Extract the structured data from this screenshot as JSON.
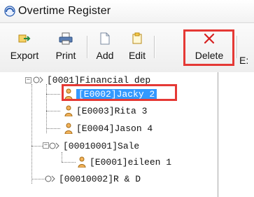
{
  "window": {
    "title": "Overtime  Register"
  },
  "toolbar": {
    "export_label": "Export",
    "print_label": "Print",
    "add_label": "Add",
    "edit_label": "Edit",
    "delete_label": "Delete",
    "next_partial_label": "E:"
  },
  "tree": {
    "root": "[0001]Financial dep",
    "items": [
      {
        "label": "[E0002]Jacky  2",
        "selected": true
      },
      {
        "label": "[E0003]Rita  3"
      },
      {
        "label": "[E0004]Jason  4"
      }
    ],
    "sub_dept": "[00010001]Sale",
    "sub_items": [
      {
        "label": "[E0001]eileen  1"
      }
    ],
    "dept2": "[00010002]R & D"
  },
  "colors": {
    "highlight": "#e53935",
    "selection": "#3399ff"
  }
}
